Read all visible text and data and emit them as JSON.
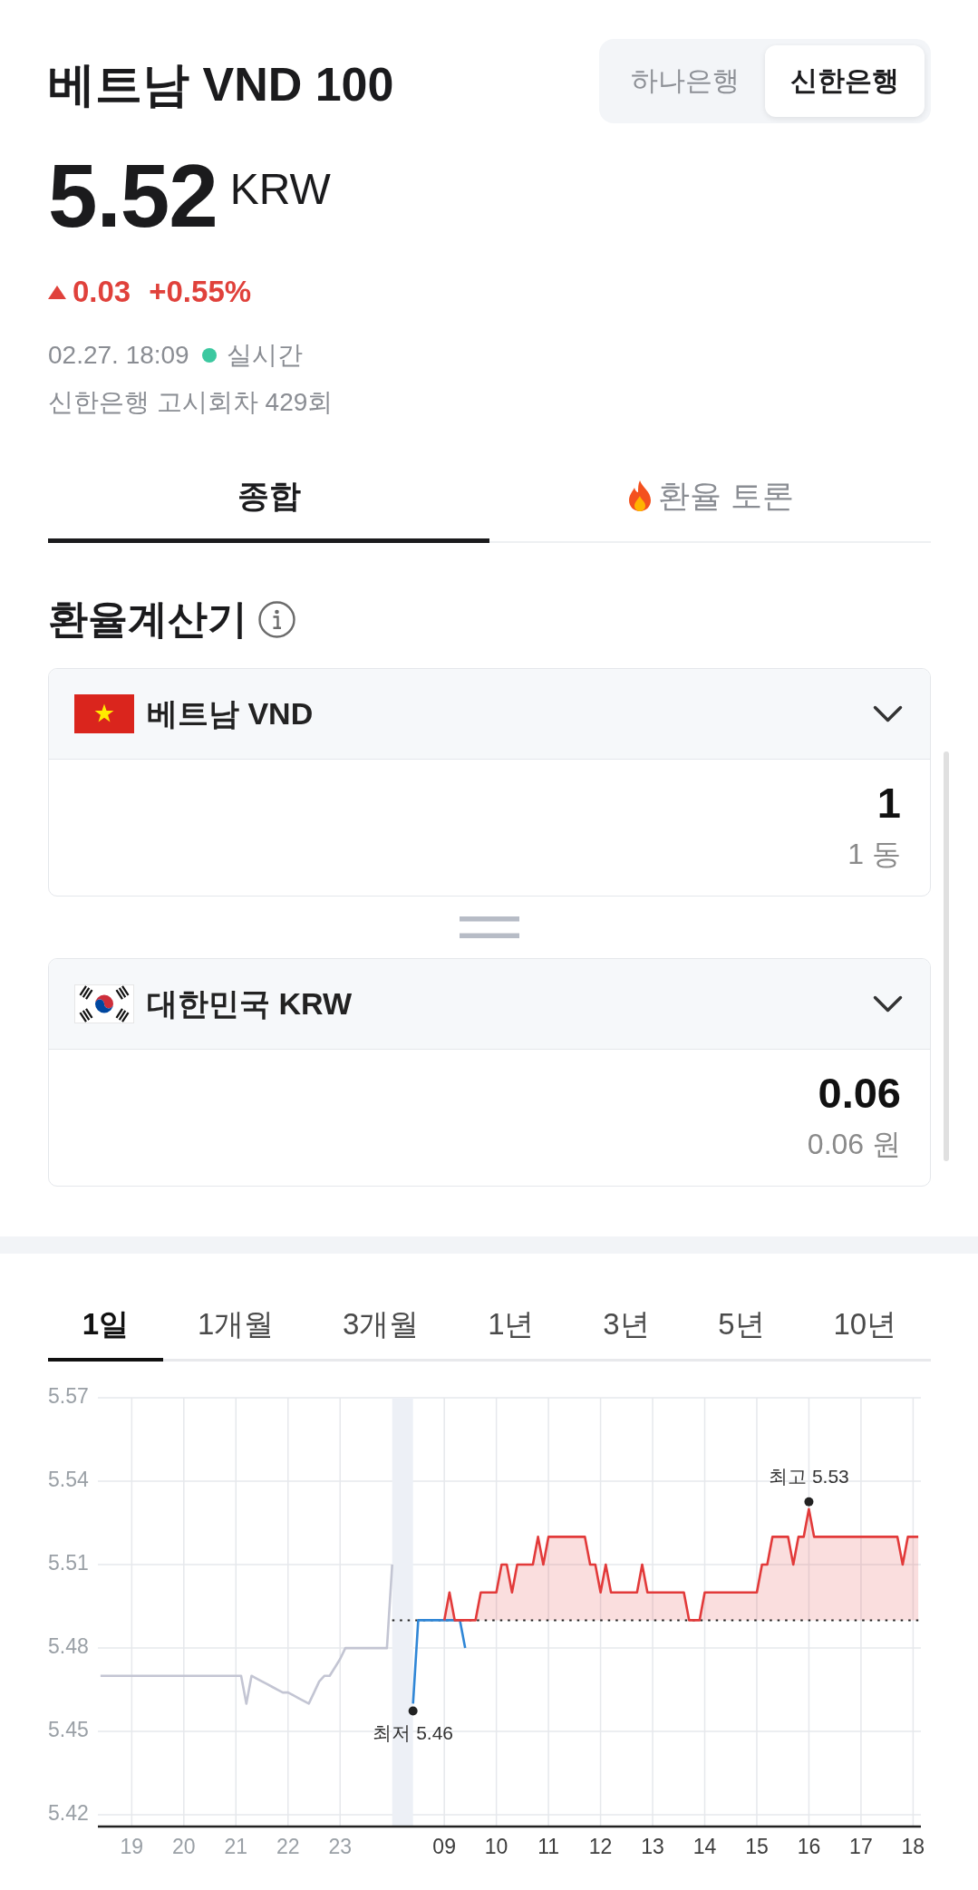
{
  "header": {
    "title": "베트남 VND 100",
    "banks": [
      {
        "label": "하나은행",
        "selected": false
      },
      {
        "label": "신한은행",
        "selected": true
      }
    ]
  },
  "quote": {
    "price": "5.52",
    "unit": "KRW",
    "change": {
      "rising": true,
      "amount": "0.03",
      "percent": "+0.55%"
    },
    "updated": "02.27. 18:09",
    "live": true,
    "live_label": "실시간",
    "notice": "신한은행 고시회차 429회"
  },
  "tabs": [
    {
      "label": "종합",
      "selected": true,
      "kind": "plain"
    },
    {
      "label": "환율 토론",
      "selected": false,
      "kind": "trending"
    }
  ],
  "calculator": {
    "title": "환율계산기",
    "converters": [
      {
        "kind": "vn",
        "currency": "베트남 VND",
        "amount": "1",
        "reading": "1 동"
      },
      {
        "kind": "kr",
        "currency": "대한민국 KRW",
        "amount": "0.06",
        "reading": "0.06 원"
      }
    ]
  },
  "chart": {
    "periods": [
      {
        "label": "1일",
        "selected": true
      },
      {
        "label": "1개월",
        "selected": false
      },
      {
        "label": "3개월",
        "selected": false
      },
      {
        "label": "1년",
        "selected": false
      },
      {
        "label": "3년",
        "selected": false
      },
      {
        "label": "5년",
        "selected": false
      },
      {
        "label": "10년",
        "selected": false
      }
    ],
    "chart_data": {
      "type": "line",
      "grid": true,
      "categories": [
        null,
        null,
        null,
        null,
        null,
        null,
        "19",
        null,
        null,
        null,
        null,
        null,
        null,
        null,
        null,
        null,
        "20",
        null,
        null,
        null,
        null,
        null,
        null,
        null,
        null,
        null,
        "21",
        null,
        null,
        null,
        null,
        null,
        null,
        null,
        null,
        null,
        "22",
        null,
        null,
        null,
        null,
        null,
        null,
        null,
        null,
        null,
        "23",
        null,
        null,
        null,
        null,
        null,
        null,
        null,
        null,
        null,
        null,
        null,
        null,
        null,
        null,
        null,
        null,
        null,
        null,
        null,
        "09",
        null,
        null,
        null,
        null,
        null,
        null,
        null,
        null,
        null,
        "10",
        null,
        null,
        null,
        null,
        null,
        null,
        null,
        null,
        null,
        "11",
        null,
        null,
        null,
        null,
        null,
        null,
        null,
        null,
        null,
        "12",
        null,
        null,
        null,
        null,
        null,
        null,
        null,
        null,
        null,
        "13",
        null,
        null,
        null,
        null,
        null,
        null,
        null,
        null,
        null,
        "14",
        null,
        null,
        null,
        null,
        null,
        null,
        null,
        null,
        null,
        "15",
        null,
        null,
        null,
        null,
        null,
        null,
        null,
        null,
        null,
        "16",
        null,
        null,
        null,
        null,
        null,
        null,
        null,
        null,
        null,
        "17",
        null,
        null,
        null,
        null,
        null,
        null,
        null,
        null,
        null,
        "18",
        null
      ],
      "series": [
        {
          "color": "#c3c5d3",
          "values": [
            5.47,
            5.47,
            5.47,
            5.47,
            5.47,
            5.47,
            5.47,
            5.47,
            5.47,
            5.47,
            5.47,
            5.47,
            5.47,
            5.47,
            5.47,
            5.47,
            5.47,
            5.47,
            5.47,
            5.47,
            5.47,
            5.47,
            5.47,
            5.47,
            5.47,
            5.47,
            5.47,
            5.47,
            5.46,
            5.47,
            5.469,
            5.468,
            5.467,
            5.466,
            5.465,
            5.464,
            5.464,
            5.463,
            5.462,
            5.461,
            5.46,
            5.464,
            5.468,
            5.47,
            5.47,
            5.473,
            5.476,
            5.48,
            5.48,
            5.48,
            5.48,
            5.48,
            5.48,
            5.48,
            5.48,
            5.48,
            5.51,
            null,
            null,
            null,
            null,
            null,
            null,
            null,
            null,
            null,
            null,
            null,
            null,
            null,
            null,
            null,
            null,
            null,
            null,
            null,
            null,
            null,
            null,
            null,
            null,
            null,
            null,
            null,
            null,
            null,
            null,
            null,
            null,
            null,
            null,
            null,
            null,
            null,
            null,
            null,
            null,
            null,
            null,
            null,
            null,
            null,
            null,
            null,
            null,
            null,
            null,
            null,
            null,
            null,
            null,
            null,
            null,
            null,
            null,
            null,
            null,
            null,
            null,
            null,
            null,
            null,
            null,
            null,
            null,
            null,
            null,
            null,
            null,
            null,
            null,
            null,
            null,
            null,
            null,
            null,
            null,
            null,
            null,
            null,
            null,
            null,
            null,
            null,
            null,
            null,
            null,
            null,
            null,
            null,
            null,
            null,
            null,
            null,
            null,
            null,
            null,
            null
          ]
        },
        {
          "color": "#2f86d6",
          "values": [
            null,
            null,
            null,
            null,
            null,
            null,
            null,
            null,
            null,
            null,
            null,
            null,
            null,
            null,
            null,
            null,
            null,
            null,
            null,
            null,
            null,
            null,
            null,
            null,
            null,
            null,
            null,
            null,
            null,
            null,
            null,
            null,
            null,
            null,
            null,
            null,
            null,
            null,
            null,
            null,
            null,
            null,
            null,
            null,
            null,
            null,
            null,
            null,
            null,
            null,
            null,
            null,
            null,
            null,
            null,
            null,
            null,
            null,
            null,
            null,
            5.46,
            5.49,
            5.49,
            5.49,
            5.49,
            5.49,
            5.49,
            5.49,
            5.49,
            5.49,
            5.48,
            null,
            null,
            null,
            null,
            null,
            null,
            null,
            null,
            null,
            null,
            null,
            null,
            null,
            null,
            null,
            null,
            null,
            null,
            null,
            null,
            null,
            null,
            null,
            null,
            null,
            null,
            null,
            null,
            null,
            null,
            null,
            null,
            null,
            null,
            null,
            null,
            null,
            null,
            null,
            null,
            null,
            null,
            null,
            null,
            null,
            null,
            null,
            null,
            null,
            null,
            null,
            null,
            null,
            null,
            null,
            null,
            null,
            null,
            null,
            null,
            null,
            null,
            null,
            null,
            null,
            null,
            null,
            null,
            null,
            null,
            null,
            null,
            null,
            null,
            null,
            null,
            null,
            null,
            null,
            null,
            null,
            null,
            null,
            null,
            null,
            null,
            null
          ]
        },
        {
          "color": "#e23a3a",
          "values": [
            null,
            null,
            null,
            null,
            null,
            null,
            null,
            null,
            null,
            null,
            null,
            null,
            null,
            null,
            null,
            null,
            null,
            null,
            null,
            null,
            null,
            null,
            null,
            null,
            null,
            null,
            null,
            null,
            null,
            null,
            null,
            null,
            null,
            null,
            null,
            null,
            null,
            null,
            null,
            null,
            null,
            null,
            null,
            null,
            null,
            null,
            null,
            null,
            null,
            null,
            null,
            null,
            null,
            null,
            null,
            null,
            null,
            null,
            null,
            null,
            null,
            null,
            null,
            null,
            null,
            null,
            5.49,
            5.5,
            5.49,
            5.49,
            5.49,
            5.49,
            5.49,
            5.5,
            5.5,
            5.5,
            5.5,
            5.51,
            5.51,
            5.5,
            5.51,
            5.51,
            5.51,
            5.51,
            5.52,
            5.51,
            5.52,
            5.52,
            5.52,
            5.52,
            5.52,
            5.52,
            5.52,
            5.52,
            5.51,
            5.51,
            5.5,
            5.51,
            5.5,
            5.5,
            5.5,
            5.5,
            5.5,
            5.5,
            5.51,
            5.5,
            5.5,
            5.5,
            5.5,
            5.5,
            5.5,
            5.5,
            5.5,
            5.49,
            5.49,
            5.49,
            5.5,
            5.5,
            5.5,
            5.5,
            5.5,
            5.5,
            5.5,
            5.5,
            5.5,
            5.5,
            5.5,
            5.51,
            5.51,
            5.52,
            5.52,
            5.52,
            5.52,
            5.51,
            5.52,
            5.52,
            5.53,
            5.52,
            5.52,
            5.52,
            5.52,
            5.52,
            5.52,
            5.52,
            5.52,
            5.52,
            5.52,
            5.52,
            5.52,
            5.52,
            5.52,
            5.52,
            5.52,
            5.52,
            5.51,
            5.52,
            5.52,
            5.52
          ]
        }
      ],
      "ylim": [
        5.4158,
        5.57
      ],
      "yticks": [
        5.42,
        5.45,
        5.48,
        5.51,
        5.54,
        5.57
      ],
      "ref_lines": [
        {
          "axis": "y",
          "value": 5.49
        }
      ],
      "annotations": [
        {
          "text": "최고 5.53",
          "y": 5.53
        },
        {
          "text": "최저 5.46",
          "y": 5.46
        }
      ]
    }
  }
}
